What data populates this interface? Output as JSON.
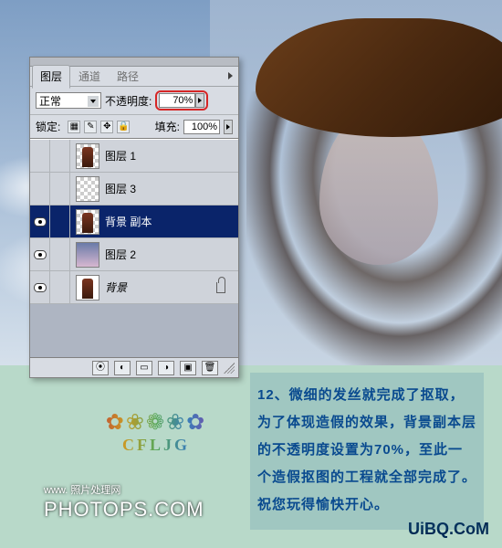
{
  "tabs": {
    "layers": "图层",
    "channels": "通道",
    "paths": "路径"
  },
  "blend": {
    "mode": "正常",
    "opacity_label": "不透明度:",
    "opacity_value": "70%"
  },
  "lockrow": {
    "label": "锁定:",
    "fill_label": "填充:",
    "fill_value": "100%"
  },
  "layers": [
    {
      "name": "图层 1",
      "visible": false,
      "thumb": "figure-checker",
      "selected": false
    },
    {
      "name": "图层 3",
      "visible": false,
      "thumb": "checker",
      "selected": false
    },
    {
      "name": "背景 副本",
      "visible": true,
      "thumb": "figure-checker",
      "selected": true
    },
    {
      "name": "图层 2",
      "visible": true,
      "thumb": "gradient",
      "selected": false
    },
    {
      "name": "背景",
      "visible": true,
      "thumb": "figure",
      "selected": false,
      "italic": true,
      "locked": true
    }
  ],
  "footer_icons": [
    "fx",
    "mask",
    "set",
    "adj",
    "new",
    "trash"
  ],
  "ornament": {
    "glyphs": "✿❀❁❀✿",
    "text": "CFLJG"
  },
  "watermarks": {
    "left_small": "www. 照片处理网",
    "left_big": "PHOTOPS.COM",
    "right": "UiBQ.CoM"
  },
  "caption": "12、微细的发丝就完成了抠取，为了体现造假的效果，背景副本层的不透明度设置为70%，至此一个造假抠图的工程就全部完成了。祝您玩得愉快开心。"
}
